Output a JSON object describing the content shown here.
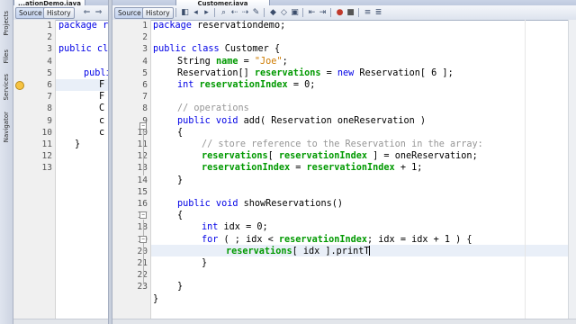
{
  "side_panels": [
    "Projects",
    "Files",
    "Services",
    "Navigator"
  ],
  "left_editor": {
    "tab_label": "...ationDemo.java",
    "toolbar": {
      "source_label": "Source",
      "history_label": "History"
    },
    "line_numbers": [
      "1",
      "2",
      "3",
      "4",
      "5",
      "6",
      "7",
      "8",
      "9",
      "10",
      "11",
      "12",
      "13"
    ],
    "code_lines": [
      "package r",
      "",
      "public cl",
      "",
      "publi",
      "F",
      "F",
      "C",
      "c",
      "c",
      "}",
      "",
      ""
    ]
  },
  "right_editor": {
    "tab_label": "Customer.java",
    "toolbar": {
      "source_label": "Source",
      "history_label": "History"
    },
    "line_numbers": [
      "1",
      "2",
      "3",
      "4",
      "5",
      "6",
      "7",
      "8",
      "9",
      "10",
      "11",
      "12",
      "13",
      "14",
      "15",
      "16",
      "17",
      "18",
      "19",
      "20",
      "21",
      "22",
      "23"
    ],
    "code": {
      "l1_kw": "package",
      "l1_rest": " reservationdemo;",
      "l3_kw": "public class",
      "l3_rest": " Customer {",
      "l4_type": "String",
      "l4_field": "name",
      "l4_eq": " = ",
      "l4_str": "\"Joe\"",
      "l4_end": ";",
      "l5_type": "Reservation[] ",
      "l5_field": "reservations",
      "l5_eq": " = ",
      "l5_kw": "new",
      "l5_end": " Reservation[ 6 ];",
      "l6_kw": "int",
      "l6_field": "reservationIndex",
      "l6_end": " = 0;",
      "l8_comment": "// operations",
      "l9_kw": "public void",
      "l9_rest": " add( Reservation oneReservation )",
      "l10_brace": "{",
      "l11_comment": "// store reference to the Reservation in the array:",
      "l12_field1": "reservations",
      "l12_mid": "[ ",
      "l12_field2": "reservationIndex",
      "l12_end": " ] = oneReservation;",
      "l13_field1": "reservationIndex",
      "l13_mid": " = ",
      "l13_field2": "reservationIndex",
      "l13_end": " + 1;",
      "l14_brace": "}",
      "l16_kw": "public void",
      "l16_rest": " showReservations()",
      "l17_brace": "{",
      "l18_kw": "int",
      "l18_rest": " idx = 0;",
      "l19_kw": "for",
      "l19_mid": " ( ; idx < ",
      "l19_field": "reservationIndex",
      "l19_end": "; idx = idx + 1 ) {",
      "l20_field": "reservations",
      "l20_end": "[ idx ].printT",
      "l21_brace": "}",
      "l23_brace": "}",
      "l24_brace": "}"
    }
  },
  "colors": {
    "keyword": "#0000e6",
    "field": "#009900",
    "string": "#ce7b00",
    "comment": "#969696"
  }
}
